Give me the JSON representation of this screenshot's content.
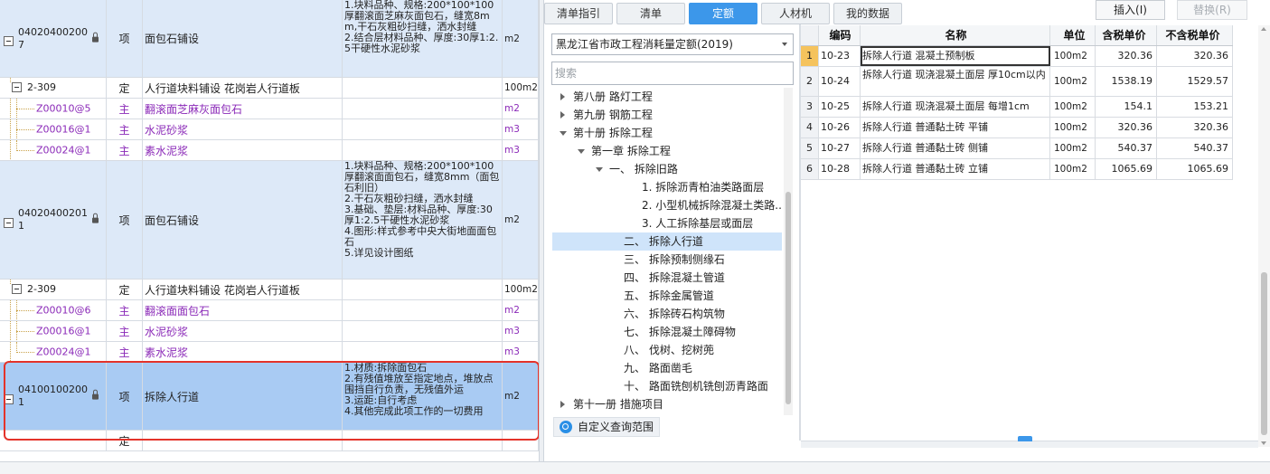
{
  "left_grid": {
    "rows": [
      {
        "kind": "item",
        "code": "040204002007",
        "type": "项",
        "name": "面包石铺设",
        "features": "1.块料品种、规格:200*100*100厚翻滚面芝麻灰面包石，缝宽8mm,干石灰粗砂扫缝，洒水封缝\n2.结合层材料品种、厚度:30厚1:2.5干硬性水泥砂浆",
        "unit": "m2"
      },
      {
        "kind": "quota",
        "code": "2-309",
        "type": "定",
        "name": "人行道块料铺设 花岗岩人行道板",
        "features": "",
        "unit": "100m2"
      },
      {
        "kind": "material",
        "code": "Z00010@5",
        "type": "主",
        "name": "翻滚面芝麻灰面包石",
        "features": "",
        "unit": "m2"
      },
      {
        "kind": "material",
        "code": "Z00016@1",
        "type": "主",
        "name": "水泥砂浆",
        "features": "",
        "unit": "m3"
      },
      {
        "kind": "material",
        "code": "Z00024@1",
        "type": "主",
        "name": "素水泥浆",
        "features": "",
        "unit": "m3"
      },
      {
        "kind": "item",
        "code": "040204002011",
        "type": "项",
        "name": "面包石铺设",
        "features": "1.块料品种、规格:200*100*100厚翻滚面面包石，缝宽8mm（面包石利旧）\n2.干石灰粗砂扫缝，洒水封缝\n3.基础、垫层:材料品种、厚度:30厚1:2.5干硬性水泥砂浆\n4.图形:样式参考中央大街地面面包石\n5.详见设计图纸",
        "unit": "m2"
      },
      {
        "kind": "quota",
        "code": "2-309",
        "type": "定",
        "name": "人行道块料铺设 花岗岩人行道板",
        "features": "",
        "unit": "100m2"
      },
      {
        "kind": "material",
        "code": "Z00010@6",
        "type": "主",
        "name": "翻滚面面包石",
        "features": "",
        "unit": "m2"
      },
      {
        "kind": "material",
        "code": "Z00016@1",
        "type": "主",
        "name": "水泥砂浆",
        "features": "",
        "unit": "m3"
      },
      {
        "kind": "material",
        "code": "Z00024@1",
        "type": "主",
        "name": "素水泥浆",
        "features": "",
        "unit": "m3"
      },
      {
        "kind": "item-selected",
        "code": "041001002001",
        "type": "项",
        "name": "拆除人行道",
        "features": "1.材质:拆除面包石\n2.有残值堆放至指定地点，堆放点围挡自行负责，无残值外运\n3.运距:自行考虑\n4.其他完成此项工作的一切费用",
        "unit": "m2"
      },
      {
        "kind": "empty",
        "code": "",
        "type": "定",
        "name": "",
        "features": "",
        "unit": ""
      }
    ]
  },
  "tabs": [
    {
      "label": "清单指引",
      "active": false
    },
    {
      "label": "清单",
      "active": false
    },
    {
      "label": "定额",
      "active": true
    },
    {
      "label": "人材机",
      "active": false
    },
    {
      "label": "我的数据",
      "active": false
    }
  ],
  "quota_library": {
    "selected": "黑龙江省市政工程消耗量定额(2019)"
  },
  "search": {
    "placeholder": "搜索"
  },
  "tree": [
    {
      "label": "第八册 路灯工程",
      "expander": "right",
      "selected": false
    },
    {
      "label": "第九册 钢筋工程",
      "expander": "right",
      "selected": false
    },
    {
      "label": "第十册 拆除工程",
      "expander": "down",
      "selected": false
    },
    {
      "label": "第一章 拆除工程",
      "expander": "down",
      "selected": false
    },
    {
      "label": "一、 拆除旧路",
      "expander": "down",
      "selected": false
    },
    {
      "label": "1. 拆除沥青柏油类路面层",
      "expander": "none",
      "selected": false
    },
    {
      "label": "2. 小型机械拆除混凝土类路...",
      "expander": "none",
      "selected": false
    },
    {
      "label": "3. 人工拆除基层或面层",
      "expander": "none",
      "selected": false
    },
    {
      "label": "二、 拆除人行道",
      "expander": "none",
      "selected": true
    },
    {
      "label": "三、 拆除预制侧缘石",
      "expander": "none",
      "selected": false
    },
    {
      "label": "四、 拆除混凝土管道",
      "expander": "none",
      "selected": false
    },
    {
      "label": "五、 拆除金属管道",
      "expander": "none",
      "selected": false
    },
    {
      "label": "六、 拆除砖石构筑物",
      "expander": "none",
      "selected": false
    },
    {
      "label": "七、 拆除混凝土障碍物",
      "expander": "none",
      "selected": false
    },
    {
      "label": "八、 伐树、挖树蔸",
      "expander": "none",
      "selected": false
    },
    {
      "label": "九、 路面凿毛",
      "expander": "none",
      "selected": false
    },
    {
      "label": "十、 路面铣刨机铣刨沥青路面",
      "expander": "none",
      "selected": false
    },
    {
      "label": "第十一册 措施项目",
      "expander": "right",
      "selected": false
    }
  ],
  "custom_scope_label": "自定义查询范围",
  "buttons": {
    "insert": "插入(I)",
    "replace": "替换(R)"
  },
  "result_table": {
    "headers": [
      "",
      "编码",
      "名称",
      "单位",
      "含税单价",
      "不含税单价"
    ],
    "rows": [
      {
        "idx": "1",
        "code": "10-23",
        "name": "拆除人行道 混凝土预制板",
        "unit": "100m2",
        "tax_price": "320.36",
        "notax_price": "320.36"
      },
      {
        "idx": "2",
        "code": "10-24",
        "name": "拆除人行道 现浇混凝土面层 厚10cm以内",
        "unit": "100m2",
        "tax_price": "1538.19",
        "notax_price": "1529.57"
      },
      {
        "idx": "3",
        "code": "10-25",
        "name": "拆除人行道 现浇混凝土面层 每增1cm",
        "unit": "100m2",
        "tax_price": "154.1",
        "notax_price": "153.21"
      },
      {
        "idx": "4",
        "code": "10-26",
        "name": "拆除人行道 普通黏土砖 平铺",
        "unit": "100m2",
        "tax_price": "320.36",
        "notax_price": "320.36"
      },
      {
        "idx": "5",
        "code": "10-27",
        "name": "拆除人行道 普通黏土砖 侧铺",
        "unit": "100m2",
        "tax_price": "540.37",
        "notax_price": "540.37"
      },
      {
        "idx": "6",
        "code": "10-28",
        "name": "拆除人行道 普通黏土砖 立铺",
        "unit": "100m2",
        "tax_price": "1065.69",
        "notax_price": "1065.69"
      }
    ]
  },
  "colors": {
    "accent": "#3c97ea",
    "selected_row": "#a9cbf3",
    "item_row": "#dde9f8",
    "highlight_box": "#e4332a",
    "material_text": "#8b2ab8"
  }
}
